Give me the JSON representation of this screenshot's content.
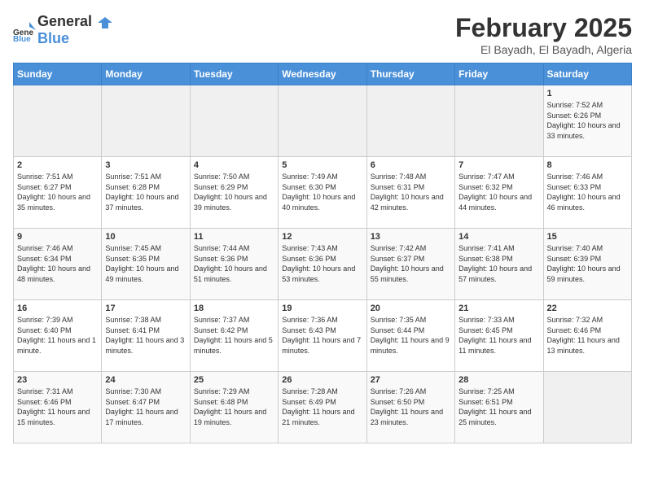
{
  "header": {
    "logo_general": "General",
    "logo_blue": "Blue",
    "title": "February 2025",
    "subtitle": "El Bayadh, El Bayadh, Algeria"
  },
  "days_of_week": [
    "Sunday",
    "Monday",
    "Tuesday",
    "Wednesday",
    "Thursday",
    "Friday",
    "Saturday"
  ],
  "weeks": [
    [
      {
        "day": "",
        "info": ""
      },
      {
        "day": "",
        "info": ""
      },
      {
        "day": "",
        "info": ""
      },
      {
        "day": "",
        "info": ""
      },
      {
        "day": "",
        "info": ""
      },
      {
        "day": "",
        "info": ""
      },
      {
        "day": "1",
        "info": "Sunrise: 7:52 AM\nSunset: 6:26 PM\nDaylight: 10 hours and 33 minutes."
      }
    ],
    [
      {
        "day": "2",
        "info": "Sunrise: 7:51 AM\nSunset: 6:27 PM\nDaylight: 10 hours and 35 minutes."
      },
      {
        "day": "3",
        "info": "Sunrise: 7:51 AM\nSunset: 6:28 PM\nDaylight: 10 hours and 37 minutes."
      },
      {
        "day": "4",
        "info": "Sunrise: 7:50 AM\nSunset: 6:29 PM\nDaylight: 10 hours and 39 minutes."
      },
      {
        "day": "5",
        "info": "Sunrise: 7:49 AM\nSunset: 6:30 PM\nDaylight: 10 hours and 40 minutes."
      },
      {
        "day": "6",
        "info": "Sunrise: 7:48 AM\nSunset: 6:31 PM\nDaylight: 10 hours and 42 minutes."
      },
      {
        "day": "7",
        "info": "Sunrise: 7:47 AM\nSunset: 6:32 PM\nDaylight: 10 hours and 44 minutes."
      },
      {
        "day": "8",
        "info": "Sunrise: 7:46 AM\nSunset: 6:33 PM\nDaylight: 10 hours and 46 minutes."
      }
    ],
    [
      {
        "day": "9",
        "info": "Sunrise: 7:46 AM\nSunset: 6:34 PM\nDaylight: 10 hours and 48 minutes."
      },
      {
        "day": "10",
        "info": "Sunrise: 7:45 AM\nSunset: 6:35 PM\nDaylight: 10 hours and 49 minutes."
      },
      {
        "day": "11",
        "info": "Sunrise: 7:44 AM\nSunset: 6:36 PM\nDaylight: 10 hours and 51 minutes."
      },
      {
        "day": "12",
        "info": "Sunrise: 7:43 AM\nSunset: 6:36 PM\nDaylight: 10 hours and 53 minutes."
      },
      {
        "day": "13",
        "info": "Sunrise: 7:42 AM\nSunset: 6:37 PM\nDaylight: 10 hours and 55 minutes."
      },
      {
        "day": "14",
        "info": "Sunrise: 7:41 AM\nSunset: 6:38 PM\nDaylight: 10 hours and 57 minutes."
      },
      {
        "day": "15",
        "info": "Sunrise: 7:40 AM\nSunset: 6:39 PM\nDaylight: 10 hours and 59 minutes."
      }
    ],
    [
      {
        "day": "16",
        "info": "Sunrise: 7:39 AM\nSunset: 6:40 PM\nDaylight: 11 hours and 1 minute."
      },
      {
        "day": "17",
        "info": "Sunrise: 7:38 AM\nSunset: 6:41 PM\nDaylight: 11 hours and 3 minutes."
      },
      {
        "day": "18",
        "info": "Sunrise: 7:37 AM\nSunset: 6:42 PM\nDaylight: 11 hours and 5 minutes."
      },
      {
        "day": "19",
        "info": "Sunrise: 7:36 AM\nSunset: 6:43 PM\nDaylight: 11 hours and 7 minutes."
      },
      {
        "day": "20",
        "info": "Sunrise: 7:35 AM\nSunset: 6:44 PM\nDaylight: 11 hours and 9 minutes."
      },
      {
        "day": "21",
        "info": "Sunrise: 7:33 AM\nSunset: 6:45 PM\nDaylight: 11 hours and 11 minutes."
      },
      {
        "day": "22",
        "info": "Sunrise: 7:32 AM\nSunset: 6:46 PM\nDaylight: 11 hours and 13 minutes."
      }
    ],
    [
      {
        "day": "23",
        "info": "Sunrise: 7:31 AM\nSunset: 6:46 PM\nDaylight: 11 hours and 15 minutes."
      },
      {
        "day": "24",
        "info": "Sunrise: 7:30 AM\nSunset: 6:47 PM\nDaylight: 11 hours and 17 minutes."
      },
      {
        "day": "25",
        "info": "Sunrise: 7:29 AM\nSunset: 6:48 PM\nDaylight: 11 hours and 19 minutes."
      },
      {
        "day": "26",
        "info": "Sunrise: 7:28 AM\nSunset: 6:49 PM\nDaylight: 11 hours and 21 minutes."
      },
      {
        "day": "27",
        "info": "Sunrise: 7:26 AM\nSunset: 6:50 PM\nDaylight: 11 hours and 23 minutes."
      },
      {
        "day": "28",
        "info": "Sunrise: 7:25 AM\nSunset: 6:51 PM\nDaylight: 11 hours and 25 minutes."
      },
      {
        "day": "",
        "info": ""
      }
    ]
  ]
}
